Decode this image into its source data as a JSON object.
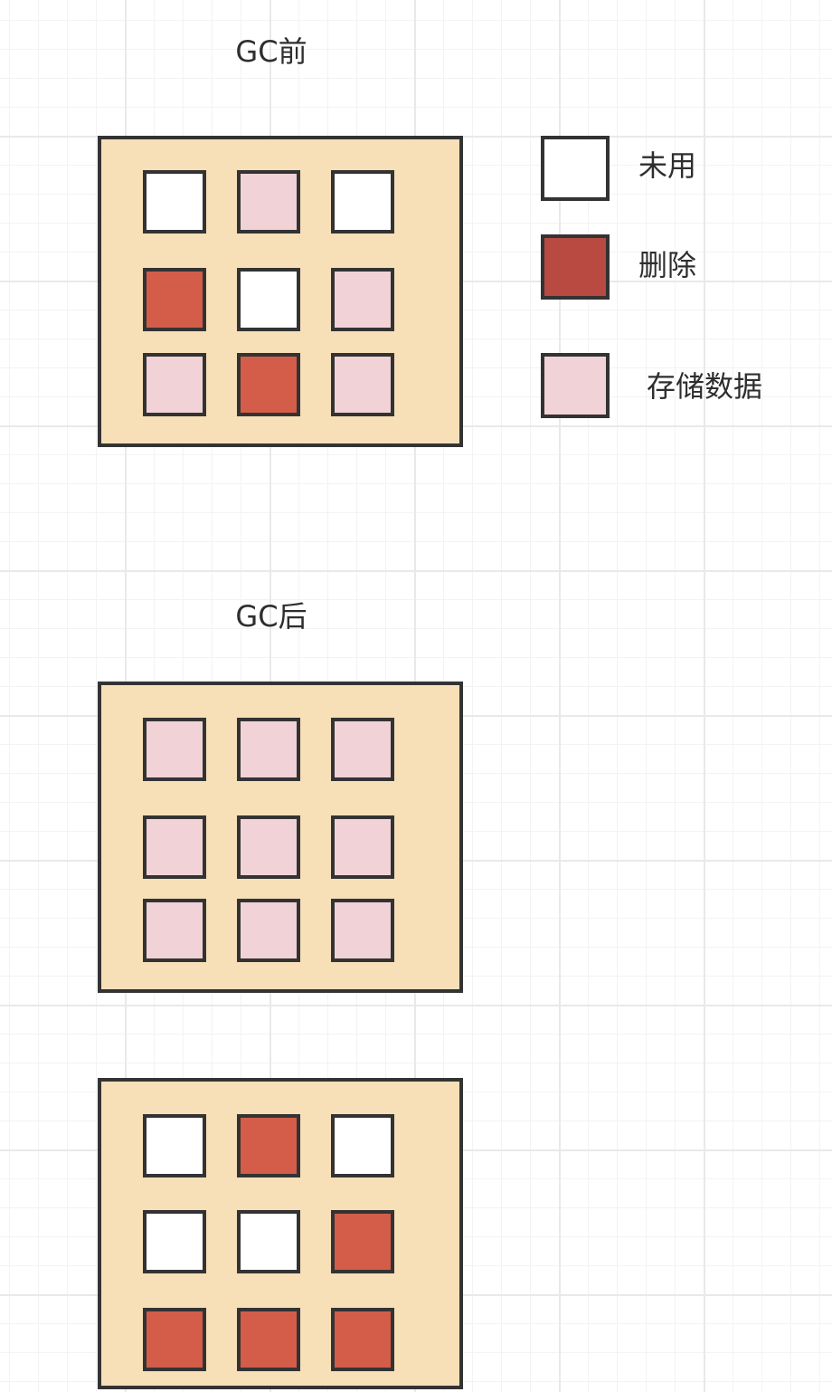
{
  "titles": {
    "before": "GC前",
    "after": "GC后"
  },
  "legend": [
    {
      "state": "unused",
      "label": "未用"
    },
    {
      "state": "deleted",
      "label": "删除"
    },
    {
      "state": "stored",
      "label": "存储数据"
    }
  ],
  "blocks": {
    "before": [
      [
        "unused",
        "stored",
        "unused"
      ],
      [
        "deleted",
        "unused",
        "stored"
      ],
      [
        "stored",
        "deleted",
        "stored"
      ]
    ],
    "after_compacted": [
      [
        "stored",
        "stored",
        "stored"
      ],
      [
        "stored",
        "stored",
        "stored"
      ],
      [
        "stored",
        "stored",
        "stored"
      ]
    ],
    "after_freed": [
      [
        "unused",
        "deleted",
        "unused"
      ],
      [
        "unused",
        "unused",
        "deleted"
      ],
      [
        "deleted",
        "deleted",
        "deleted"
      ]
    ]
  },
  "colors": {
    "unused": "#ffffff",
    "deleted": "#d35d49",
    "legend_deleted": "#b84a42",
    "stored": "#f1d2d6",
    "panel": "#f7dfb8",
    "border": "#333333"
  }
}
